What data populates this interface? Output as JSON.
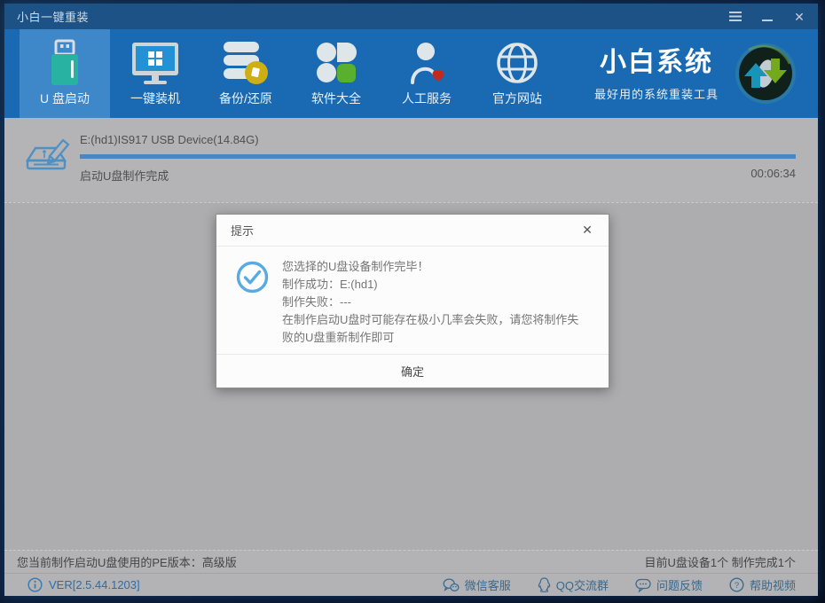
{
  "window": {
    "title": "小白一键重装"
  },
  "icons": {
    "close": "✕"
  },
  "colors": {
    "titlebar_bg": "#1d5286",
    "nav_bg": "#196ab2",
    "tab_selected_bg": "#3e87c9",
    "progress_blue": "#4d85be",
    "check_blue": "#58aae3",
    "version_blue": "#2b6da8"
  },
  "nav": {
    "tabs": [
      {
        "label": "U 盘启动",
        "icon": "usb-drive",
        "selected": true
      },
      {
        "label": "一键装机",
        "icon": "monitor-windows",
        "selected": false
      },
      {
        "label": "备份/还原",
        "icon": "database-backup",
        "selected": false
      },
      {
        "label": "软件大全",
        "icon": "software-clover",
        "selected": false
      },
      {
        "label": "人工服务",
        "icon": "customer-service",
        "selected": false
      },
      {
        "label": "官方网站",
        "icon": "globe",
        "selected": false
      }
    ],
    "brand": {
      "name": "小白系统",
      "tagline": "最好用的系统重装工具"
    }
  },
  "progress": {
    "device": "E:(hd1)IS917 USB Device(14.84G)",
    "status": "启动U盘制作完成",
    "elapsed": "00:06:34",
    "percent": 100
  },
  "dialog": {
    "title": "提示",
    "lines": [
      "您选择的U盘设备制作完毕！",
      "制作成功：E:(hd1)",
      "制作失败：---",
      "在制作启动U盘时可能存在极小几率会失败，请您将制作失败的U盘重新制作即可"
    ],
    "ok_label": "确定"
  },
  "status_bar": {
    "left": "您当前制作启动U盘使用的PE版本：高级版",
    "right": "目前U盘设备1个 制作完成1个"
  },
  "footer": {
    "version": "VER[2.5.44.1203]",
    "links": [
      {
        "label": "微信客服",
        "icon": "wechat"
      },
      {
        "label": "QQ交流群",
        "icon": "qq"
      },
      {
        "label": "问题反馈",
        "icon": "feedback-bubble"
      },
      {
        "label": "帮助视频",
        "icon": "help-circle"
      }
    ]
  }
}
